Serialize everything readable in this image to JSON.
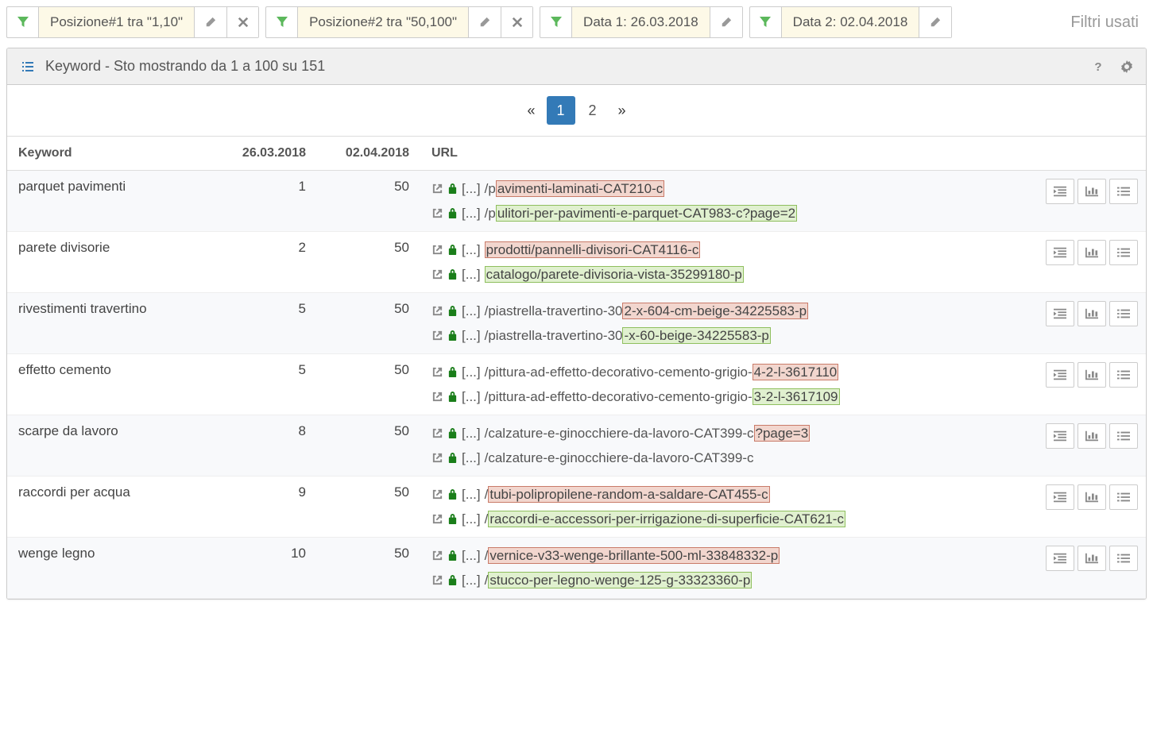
{
  "filters_label": "Filtri usati",
  "filters": [
    {
      "text": "Posizione#1 tra \"1,10\"",
      "editable": true,
      "removable": true
    },
    {
      "text": "Posizione#2 tra \"50,100\"",
      "editable": true,
      "removable": true
    },
    {
      "text": "Data 1: 26.03.2018",
      "editable": true,
      "removable": false
    },
    {
      "text": "Data 2: 02.04.2018",
      "editable": true,
      "removable": false
    }
  ],
  "panel": {
    "title": "Keyword - Sto mostrando da 1 a 100 su 151"
  },
  "pagination": {
    "pages": [
      "1",
      "2"
    ],
    "active": "1"
  },
  "columns": {
    "keyword": "Keyword",
    "date1": "26.03.2018",
    "date2": "02.04.2018",
    "url": "URL"
  },
  "rows": [
    {
      "keyword": "parquet pavimenti",
      "v1": "1",
      "v2": "50",
      "urls": [
        {
          "prefix": "[...]",
          "parts": [
            {
              "t": "/p"
            },
            {
              "t": "avimenti-laminati-CAT210-c",
              "hl": "red"
            }
          ]
        },
        {
          "prefix": "[...]",
          "parts": [
            {
              "t": "/p"
            },
            {
              "t": "ulitori-per-pavimenti-e-parquet-CAT983-c?page=2",
              "hl": "green"
            }
          ]
        }
      ]
    },
    {
      "keyword": "parete divisorie",
      "v1": "2",
      "v2": "50",
      "urls": [
        {
          "prefix": "[...]",
          "parts": [
            {
              "t": "prodotti/pannelli-divisori-CAT4116-c",
              "hl": "red"
            }
          ]
        },
        {
          "prefix": "[...]",
          "parts": [
            {
              "t": "catalogo/parete-divisoria-vista-35299180-p",
              "hl": "green"
            }
          ]
        }
      ]
    },
    {
      "keyword": "rivestimenti travertino",
      "v1": "5",
      "v2": "50",
      "urls": [
        {
          "prefix": "[...]",
          "parts": [
            {
              "t": "/piastrella-travertino-30"
            },
            {
              "t": "2-x-604-cm-beige-34225583-p",
              "hl": "red"
            }
          ]
        },
        {
          "prefix": "[...]",
          "parts": [
            {
              "t": "/piastrella-travertino-30"
            },
            {
              "t": "-x-60-beige-34225583-p",
              "hl": "green"
            }
          ]
        }
      ]
    },
    {
      "keyword": "effetto cemento",
      "v1": "5",
      "v2": "50",
      "urls": [
        {
          "prefix": "[...]",
          "parts": [
            {
              "t": "/pittura-ad-effetto-decorativo-cemento-grigio-"
            },
            {
              "t": "4-2-l-3617110",
              "hl": "red"
            }
          ]
        },
        {
          "prefix": "[...]",
          "parts": [
            {
              "t": "/pittura-ad-effetto-decorativo-cemento-grigio-"
            },
            {
              "t": "3-2-l-3617109",
              "hl": "green"
            }
          ]
        }
      ]
    },
    {
      "keyword": "scarpe da lavoro",
      "v1": "8",
      "v2": "50",
      "urls": [
        {
          "prefix": "[...]",
          "parts": [
            {
              "t": "/calzature-e-ginocchiere-da-lavoro-CAT399-c"
            },
            {
              "t": "?page=3",
              "hl": "red"
            }
          ]
        },
        {
          "prefix": "[...]",
          "parts": [
            {
              "t": "/calzature-e-ginocchiere-da-lavoro-CAT399-c"
            }
          ]
        }
      ]
    },
    {
      "keyword": "raccordi per acqua",
      "v1": "9",
      "v2": "50",
      "urls": [
        {
          "prefix": "[...]",
          "parts": [
            {
              "t": "/"
            },
            {
              "t": "tubi-polipropilene-random-a-saldare-CAT455-c",
              "hl": "red"
            }
          ]
        },
        {
          "prefix": "[...]",
          "parts": [
            {
              "t": "/"
            },
            {
              "t": "raccordi-e-accessori-per-irrigazione-di-superficie-CAT621-c",
              "hl": "green"
            }
          ]
        }
      ]
    },
    {
      "keyword": "wenge legno",
      "v1": "10",
      "v2": "50",
      "urls": [
        {
          "prefix": "[...]",
          "parts": [
            {
              "t": "/"
            },
            {
              "t": "vernice-v33-wenge-brillante-500-ml-33848332-p",
              "hl": "red"
            }
          ]
        },
        {
          "prefix": "[...]",
          "parts": [
            {
              "t": "/"
            },
            {
              "t": "stucco-per-legno-wenge-125-g-33323360-p",
              "hl": "green"
            }
          ]
        }
      ]
    }
  ]
}
